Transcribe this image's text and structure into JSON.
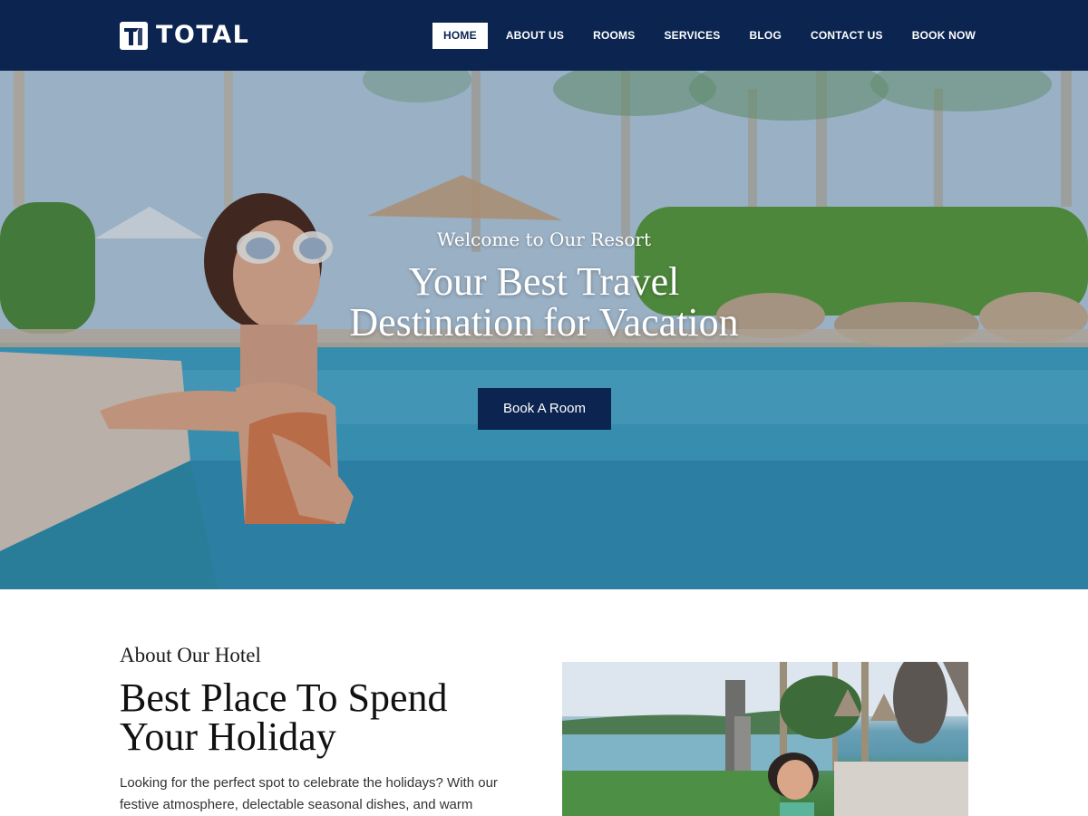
{
  "brand": {
    "name": "TOTAL"
  },
  "nav": {
    "items": [
      {
        "label": "HOME",
        "active": true
      },
      {
        "label": "ABOUT US",
        "active": false
      },
      {
        "label": "ROOMS",
        "active": false
      },
      {
        "label": "SERVICES",
        "active": false
      },
      {
        "label": "BLOG",
        "active": false
      },
      {
        "label": "CONTACT US",
        "active": false
      },
      {
        "label": "BOOK NOW",
        "active": false
      }
    ]
  },
  "hero": {
    "subtitle": "Welcome to Our Resort",
    "title_line1": "Your Best Travel",
    "title_line2": "Destination for Vacation",
    "cta_label": "Book A Room"
  },
  "about": {
    "kicker": "About Our Hotel",
    "title_line1": "Best Place To Spend",
    "title_line2": "Your Holiday",
    "text": "Looking for the perfect spot to celebrate the holidays? With our festive atmosphere, delectable seasonal dishes, and warm"
  },
  "colors": {
    "header_bg": "#0b2450",
    "accent": "#0b2450",
    "text_dark": "#111111"
  },
  "icons": {
    "logo": "logo-mark-icon"
  }
}
